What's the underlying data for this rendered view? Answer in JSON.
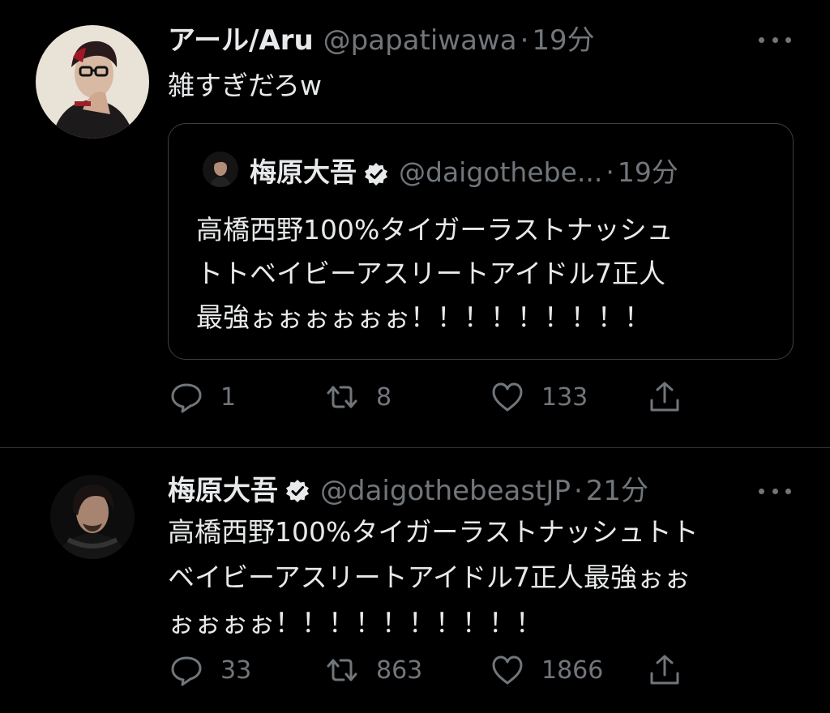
{
  "tweets": [
    {
      "name": "アール/Aru",
      "handle": "@papatiwawa",
      "sep": "·",
      "time": "19分",
      "text": "雑すぎだろw",
      "quoted": {
        "name": "梅原大吾",
        "handle": "@daigothebe...",
        "sep": "·",
        "time": "19分",
        "text_lines": [
          "高橋西野100%タイガーラストナッシュ",
          "トトベイビーアスリートアイドル7正人",
          "最強ぉぉぉぉぉぉ！！！！！！！！！"
        ]
      },
      "replies": "1",
      "retweets": "8",
      "likes": "133"
    },
    {
      "name": "梅原大吾",
      "handle": "@daigothebeastJP",
      "sep": "·",
      "time": "21分",
      "text_lines": [
        "高橋西野100%タイガーラストナッシュトト",
        "ベイビーアスリートアイドル7正人最強ぉぉ",
        "ぉぉぉぉ！！！！！！！！！！"
      ],
      "replies": "33",
      "retweets": "863",
      "likes": "1866"
    }
  ],
  "icons": {
    "reply": "reply-icon",
    "retweet": "retweet-icon",
    "like": "heart-icon",
    "share": "share-icon",
    "more": "more-icon",
    "verified": "verified-badge-icon"
  },
  "colors": {
    "background": "#000000",
    "text": "#e7e9ea",
    "secondary": "#71767b",
    "border": "#2f3336"
  }
}
